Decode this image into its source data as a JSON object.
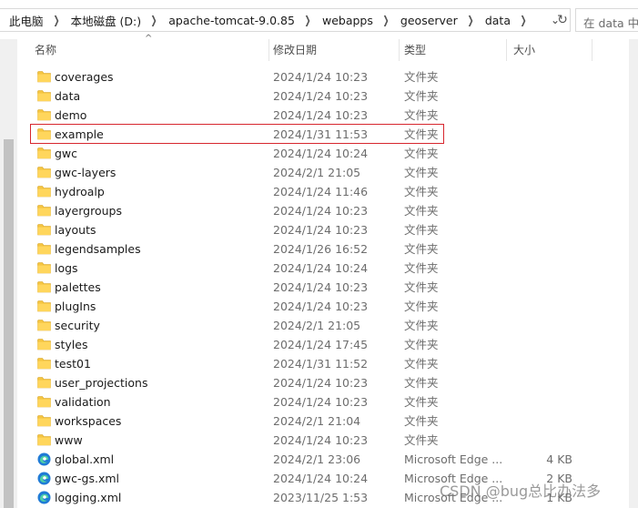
{
  "address_bar": {
    "breadcrumbs": [
      "此电脑",
      "本地磁盘 (D:)",
      "apache-tomcat-9.0.85",
      "webapps",
      "geoserver",
      "data"
    ],
    "search_placeholder": "在 data 中搜索"
  },
  "columns": {
    "name": "名称",
    "date": "修改日期",
    "type": "类型",
    "size": "大小"
  },
  "files": [
    {
      "name": "coverages",
      "date": "2024/1/24 10:23",
      "type": "文件夹",
      "size": "",
      "icon": "folder-icon"
    },
    {
      "name": "data",
      "date": "2024/1/24 10:23",
      "type": "文件夹",
      "size": "",
      "icon": "folder-icon"
    },
    {
      "name": "demo",
      "date": "2024/1/24 10:23",
      "type": "文件夹",
      "size": "",
      "icon": "folder-icon"
    },
    {
      "name": "example",
      "date": "2024/1/31 11:53",
      "type": "文件夹",
      "size": "",
      "icon": "folder-icon"
    },
    {
      "name": "gwc",
      "date": "2024/1/24 10:24",
      "type": "文件夹",
      "size": "",
      "icon": "folder-icon"
    },
    {
      "name": "gwc-layers",
      "date": "2024/2/1 21:05",
      "type": "文件夹",
      "size": "",
      "icon": "folder-icon"
    },
    {
      "name": "hydroalp",
      "date": "2024/1/24 11:46",
      "type": "文件夹",
      "size": "",
      "icon": "folder-icon"
    },
    {
      "name": "layergroups",
      "date": "2024/1/24 10:23",
      "type": "文件夹",
      "size": "",
      "icon": "folder-icon"
    },
    {
      "name": "layouts",
      "date": "2024/1/24 10:23",
      "type": "文件夹",
      "size": "",
      "icon": "folder-icon"
    },
    {
      "name": "legendsamples",
      "date": "2024/1/26 16:52",
      "type": "文件夹",
      "size": "",
      "icon": "folder-icon"
    },
    {
      "name": "logs",
      "date": "2024/1/24 10:24",
      "type": "文件夹",
      "size": "",
      "icon": "folder-icon"
    },
    {
      "name": "palettes",
      "date": "2024/1/24 10:23",
      "type": "文件夹",
      "size": "",
      "icon": "folder-icon"
    },
    {
      "name": "plugIns",
      "date": "2024/1/24 10:23",
      "type": "文件夹",
      "size": "",
      "icon": "folder-icon"
    },
    {
      "name": "security",
      "date": "2024/2/1 21:05",
      "type": "文件夹",
      "size": "",
      "icon": "folder-icon"
    },
    {
      "name": "styles",
      "date": "2024/1/24 17:45",
      "type": "文件夹",
      "size": "",
      "icon": "folder-icon"
    },
    {
      "name": "test01",
      "date": "2024/1/31 11:52",
      "type": "文件夹",
      "size": "",
      "icon": "folder-icon"
    },
    {
      "name": "user_projections",
      "date": "2024/1/24 10:23",
      "type": "文件夹",
      "size": "",
      "icon": "folder-icon"
    },
    {
      "name": "validation",
      "date": "2024/1/24 10:23",
      "type": "文件夹",
      "size": "",
      "icon": "folder-icon"
    },
    {
      "name": "workspaces",
      "date": "2024/2/1 21:04",
      "type": "文件夹",
      "size": "",
      "icon": "folder-icon"
    },
    {
      "name": "www",
      "date": "2024/1/24 10:23",
      "type": "文件夹",
      "size": "",
      "icon": "folder-icon"
    },
    {
      "name": "global.xml",
      "date": "2024/2/1 23:06",
      "type": "Microsoft Edge ...",
      "size": "4 KB",
      "icon": "edge-xml-icon"
    },
    {
      "name": "gwc-gs.xml",
      "date": "2024/1/24 10:24",
      "type": "Microsoft Edge ...",
      "size": "2 KB",
      "icon": "edge-xml-icon"
    },
    {
      "name": "logging.xml",
      "date": "2023/11/25 1:53",
      "type": "Microsoft Edge ...",
      "size": "1 KB",
      "icon": "edge-xml-icon"
    }
  ],
  "highlighted_file": "example",
  "watermark": "CSDN @bug总比办法多",
  "colors": {
    "folder": "#f5c542",
    "highlight_border": "#d7262e",
    "edge_icon": "#1f7bd6"
  }
}
